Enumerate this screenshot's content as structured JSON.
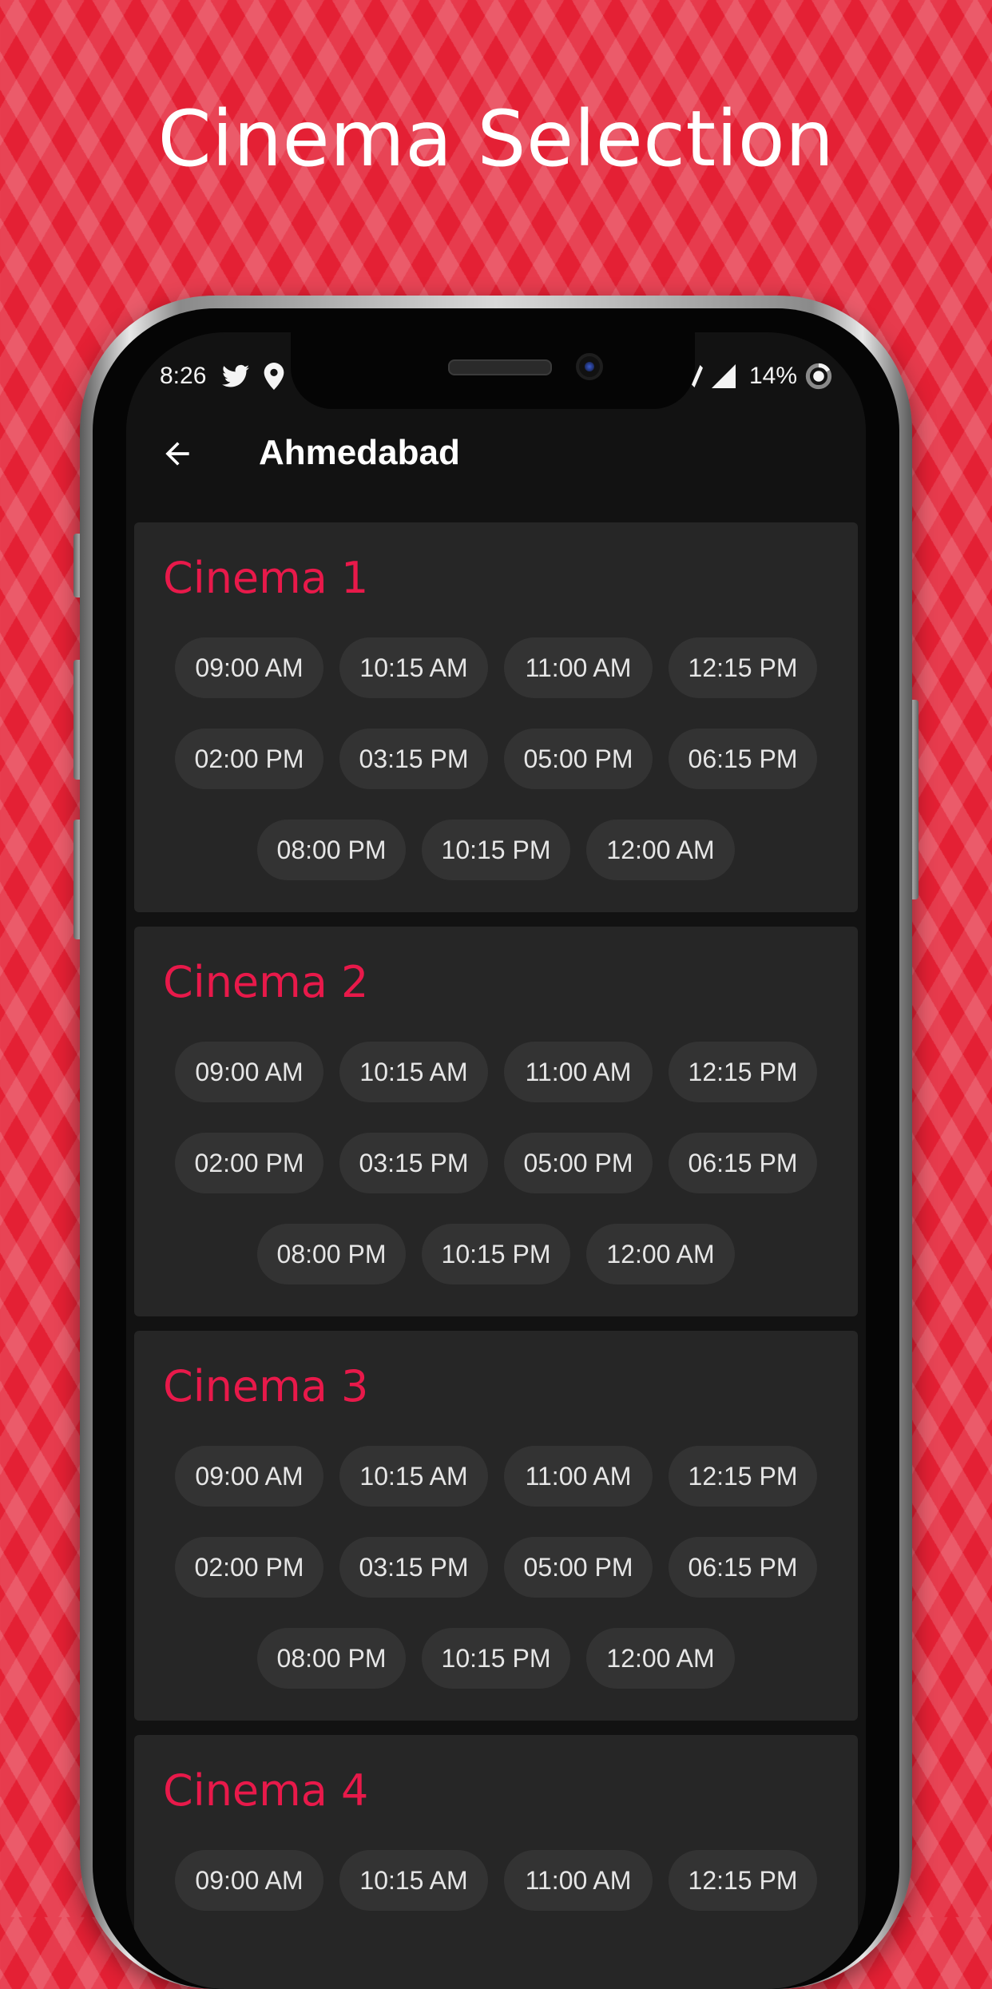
{
  "page": {
    "title": "Cinema Selection"
  },
  "status_bar": {
    "time": "8:26",
    "battery": "14%",
    "icons": [
      "twitter-icon",
      "location-icon",
      "nfc-icon",
      "signal-icon",
      "battery-icon"
    ]
  },
  "app_bar": {
    "title": "Ahmedabad",
    "back_icon": "back-arrow-icon"
  },
  "colors": {
    "background": "#e42034",
    "accent": "#e8194a",
    "card": "#262626",
    "chip": "#333333",
    "screen": "#121212"
  },
  "cinemas": [
    {
      "name": "Cinema 1",
      "rows": [
        [
          "09:00 AM",
          "10:15 AM",
          "11:00 AM",
          "12:15 PM"
        ],
        [
          "02:00 PM",
          "03:15 PM",
          "05:00 PM",
          "06:15 PM"
        ],
        [
          "08:00 PM",
          "10:15 PM",
          "12:00 AM"
        ]
      ]
    },
    {
      "name": "Cinema 2",
      "rows": [
        [
          "09:00 AM",
          "10:15 AM",
          "11:00 AM",
          "12:15 PM"
        ],
        [
          "02:00 PM",
          "03:15 PM",
          "05:00 PM",
          "06:15 PM"
        ],
        [
          "08:00 PM",
          "10:15 PM",
          "12:00 AM"
        ]
      ]
    },
    {
      "name": "Cinema 3",
      "rows": [
        [
          "09:00 AM",
          "10:15 AM",
          "11:00 AM",
          "12:15 PM"
        ],
        [
          "02:00 PM",
          "03:15 PM",
          "05:00 PM",
          "06:15 PM"
        ],
        [
          "08:00 PM",
          "10:15 PM",
          "12:00 AM"
        ]
      ]
    },
    {
      "name": "Cinema 4",
      "rows": [
        [
          "09:00 AM",
          "10:15 AM",
          "11:00 AM",
          "12:15 PM"
        ]
      ]
    }
  ]
}
